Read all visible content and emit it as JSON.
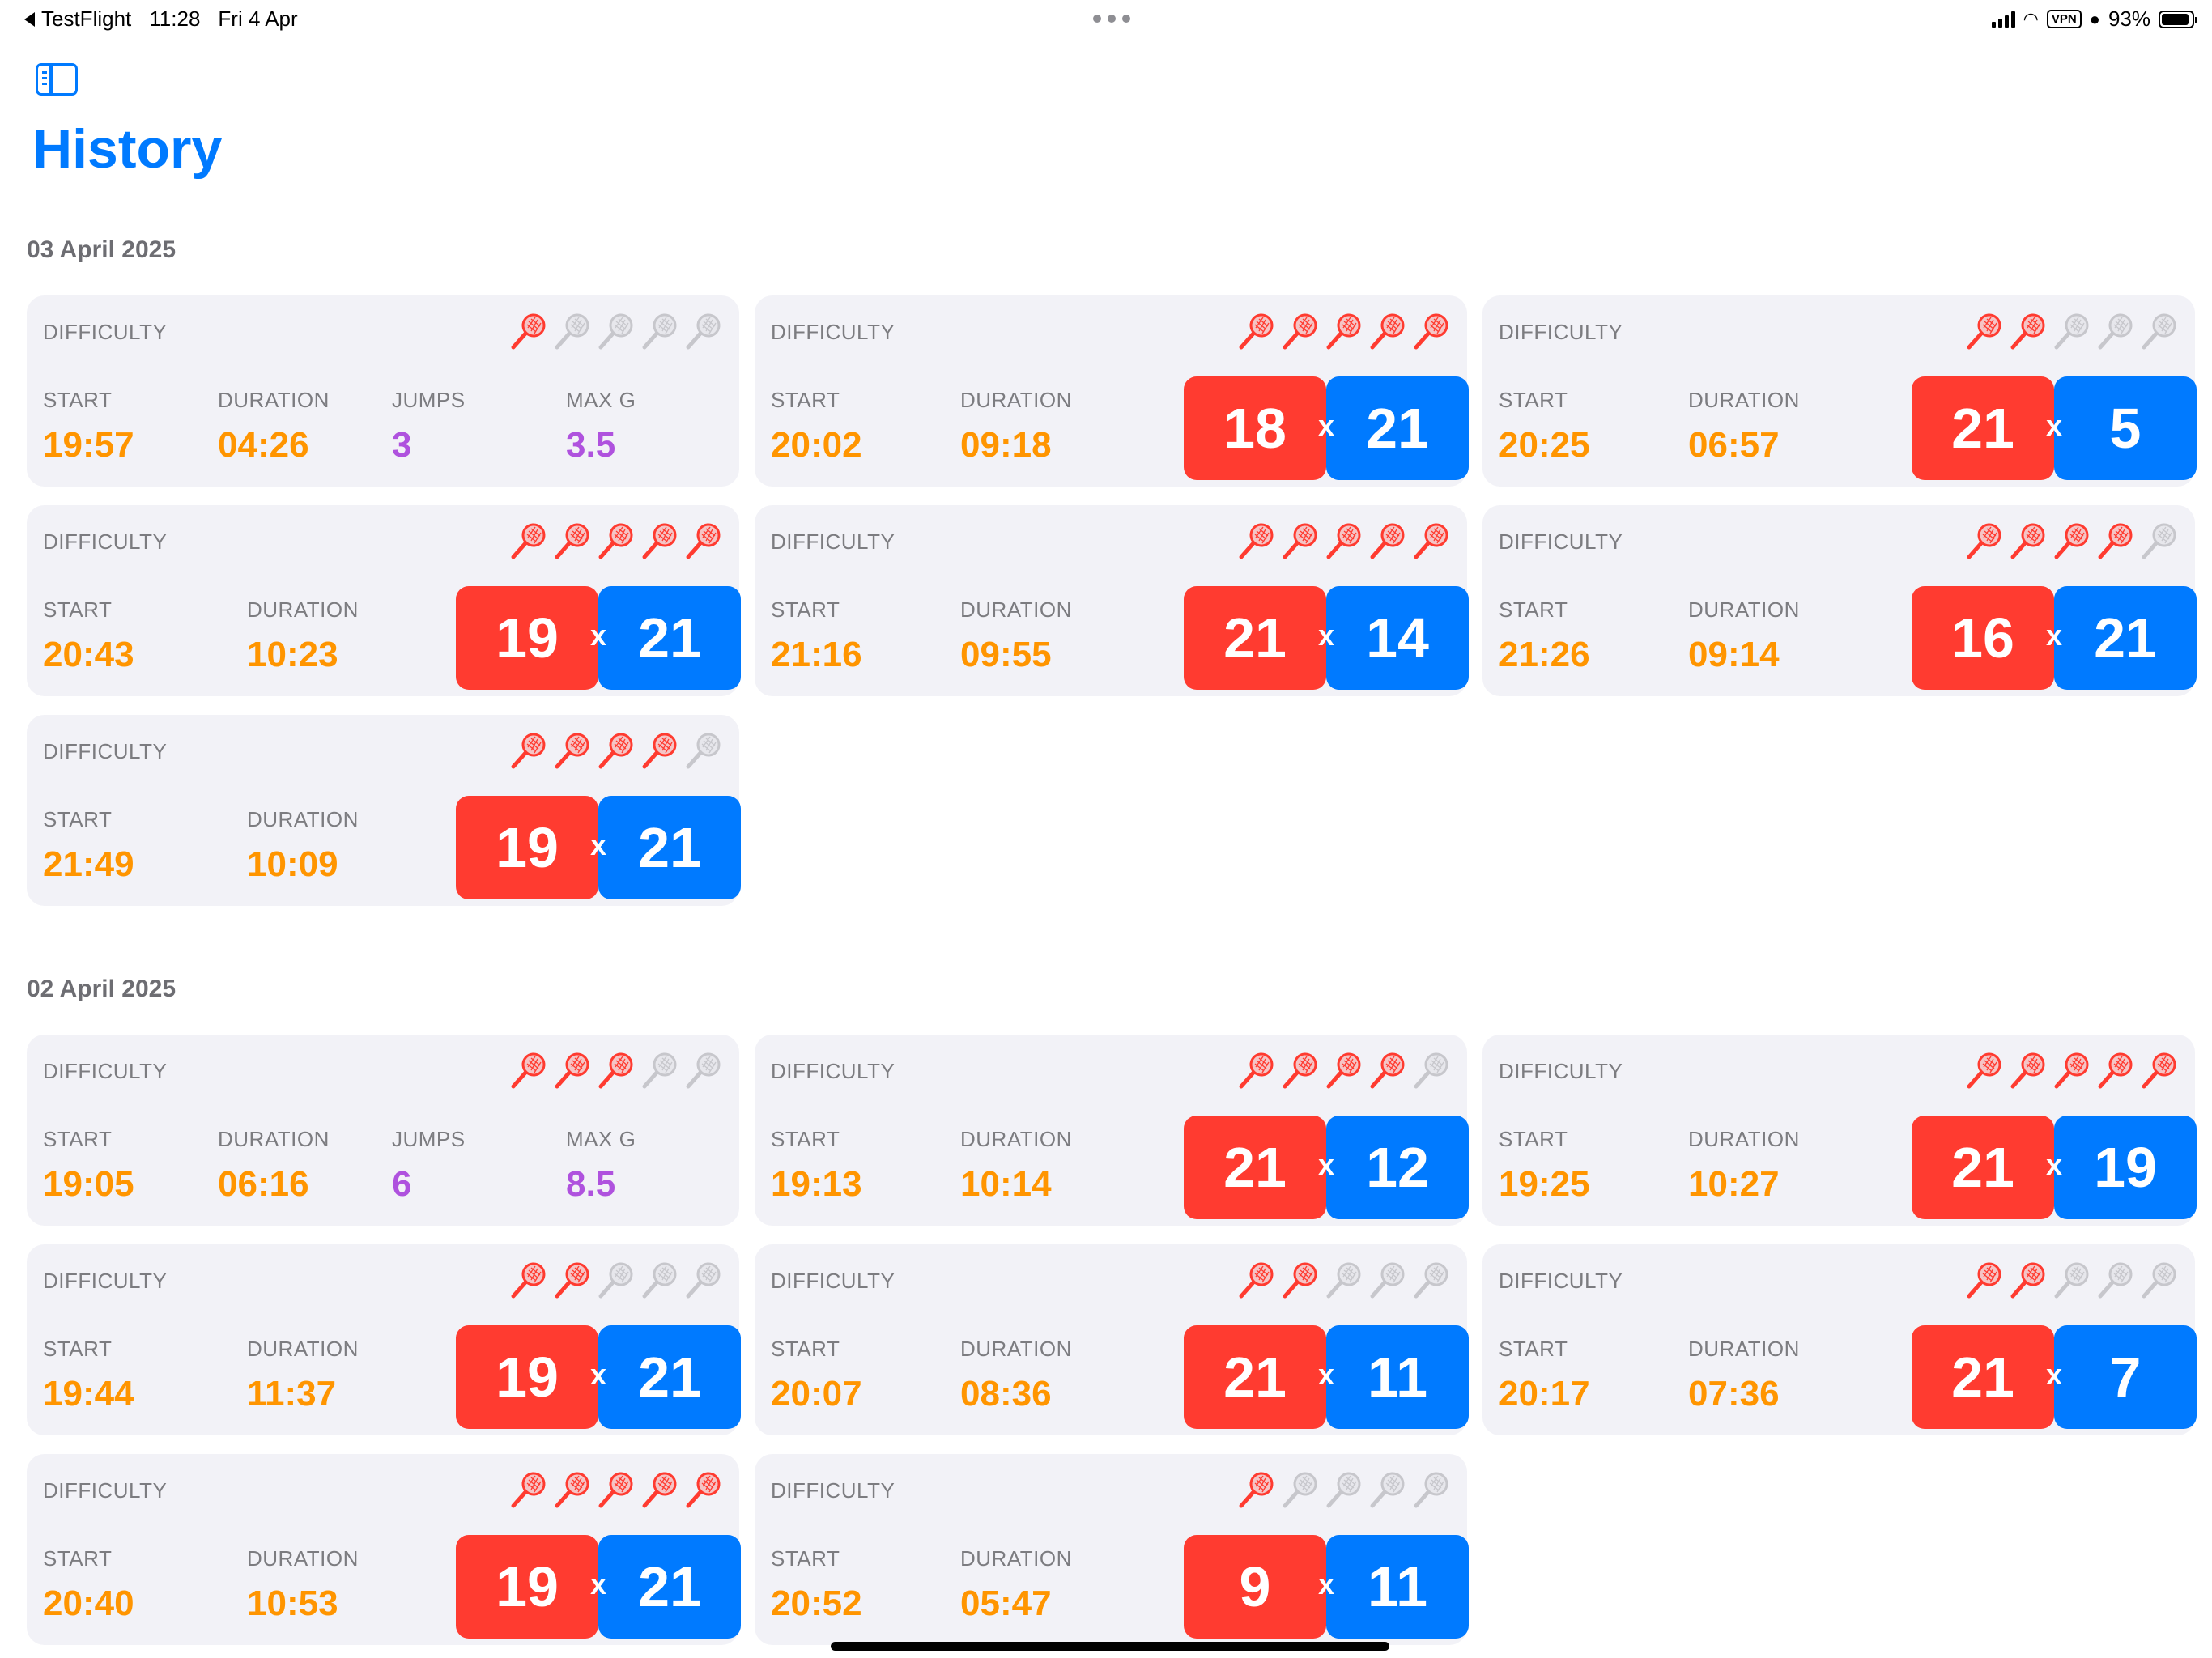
{
  "status_bar": {
    "back_app": "TestFlight",
    "time": "11:28",
    "date": "Fri 4 Apr",
    "vpn": "VPN",
    "battery": "93%"
  },
  "header": {
    "title": "History"
  },
  "colors": {
    "accent": "#007aff",
    "orange": "#ff9500",
    "purple": "#af52de",
    "team_red": "#ff3b30",
    "team_blue": "#007aff",
    "card_bg": "#f2f2f7"
  },
  "labels": {
    "difficulty": "DIFFICULTY",
    "start": "START",
    "duration": "DURATION",
    "jumps": "JUMPS",
    "max_g": "MAX G",
    "score_separator": "x"
  },
  "sections": [
    {
      "date": "03 April 2025",
      "sessions": [
        {
          "difficulty": 1,
          "start": "19:57",
          "duration": "04:26",
          "jumps": "3",
          "max_g": "3.5"
        },
        {
          "difficulty": 5,
          "start": "20:02",
          "duration": "09:18",
          "score_red": "18",
          "score_blue": "21"
        },
        {
          "difficulty": 2,
          "start": "20:25",
          "duration": "06:57",
          "score_red": "21",
          "score_blue": "5"
        },
        {
          "difficulty": 5,
          "start": "20:43",
          "duration": "10:23",
          "score_red": "19",
          "score_blue": "21"
        },
        {
          "difficulty": 5,
          "start": "21:16",
          "duration": "09:55",
          "score_red": "21",
          "score_blue": "14"
        },
        {
          "difficulty": 4,
          "start": "21:26",
          "duration": "09:14",
          "score_red": "16",
          "score_blue": "21"
        },
        {
          "difficulty": 4,
          "start": "21:49",
          "duration": "10:09",
          "score_red": "19",
          "score_blue": "21"
        }
      ]
    },
    {
      "date": "02 April 2025",
      "sessions": [
        {
          "difficulty": 3,
          "start": "19:05",
          "duration": "06:16",
          "jumps": "6",
          "max_g": "8.5"
        },
        {
          "difficulty": 4,
          "start": "19:13",
          "duration": "10:14",
          "score_red": "21",
          "score_blue": "12"
        },
        {
          "difficulty": 5,
          "start": "19:25",
          "duration": "10:27",
          "score_red": "21",
          "score_blue": "19"
        },
        {
          "difficulty": 2,
          "start": "19:44",
          "duration": "11:37",
          "score_red": "19",
          "score_blue": "21"
        },
        {
          "difficulty": 2,
          "start": "20:07",
          "duration": "08:36",
          "score_red": "21",
          "score_blue": "11"
        },
        {
          "difficulty": 2,
          "start": "20:17",
          "duration": "07:36",
          "score_red": "21",
          "score_blue": "7"
        },
        {
          "difficulty": 5,
          "start": "20:40",
          "duration": "10:53",
          "score_red": "19",
          "score_blue": "21"
        },
        {
          "difficulty": 1,
          "start": "20:52",
          "duration": "05:47",
          "score_red": "9",
          "score_blue": "11"
        }
      ]
    }
  ]
}
